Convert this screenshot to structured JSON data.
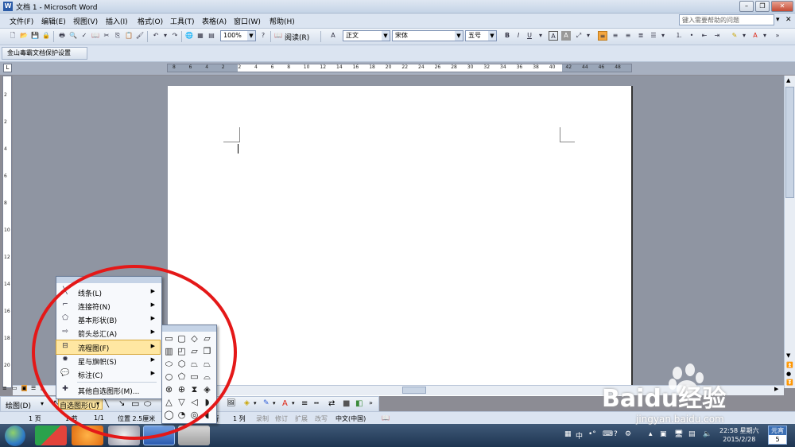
{
  "window": {
    "title": "文档 1 - Microsoft Word"
  },
  "menubar": {
    "items": [
      "文件(F)",
      "编辑(E)",
      "视图(V)",
      "插入(I)",
      "格式(O)",
      "工具(T)",
      "表格(A)",
      "窗口(W)",
      "帮助(H)"
    ],
    "help_placeholder": "键入需要帮助的问题"
  },
  "toolbar": {
    "zoom": "100%",
    "read_label": "阅读(R)",
    "style": "正文",
    "font": "宋体",
    "size": "五号"
  },
  "toolbar2": {
    "protect_label": "金山毒霸文档保护设置"
  },
  "ruler": {
    "h_numbers": [
      "8",
      "6",
      "4",
      "2",
      "2",
      "4",
      "6",
      "8",
      "10",
      "12",
      "14",
      "16",
      "18",
      "20",
      "22",
      "24",
      "26",
      "28",
      "30",
      "32",
      "34",
      "36",
      "38",
      "40",
      "42",
      "44",
      "46",
      "48"
    ],
    "v_numbers": [
      "2",
      "2",
      "4",
      "6",
      "8",
      "10",
      "12",
      "14",
      "16",
      "18",
      "20"
    ]
  },
  "autoshape_menu": {
    "items": [
      {
        "label": "线条(L)",
        "icon": "line-icon",
        "sub": true
      },
      {
        "label": "连接符(N)",
        "icon": "connector-icon",
        "sub": true
      },
      {
        "label": "基本形状(B)",
        "icon": "basic-shapes-icon",
        "sub": true
      },
      {
        "label": "箭头总汇(A)",
        "icon": "arrows-icon",
        "sub": true
      },
      {
        "label": "流程图(F)",
        "icon": "flowchart-icon",
        "sub": true,
        "highlighted": true
      },
      {
        "label": "星与旗帜(S)",
        "icon": "star-icon",
        "sub": true
      },
      {
        "label": "标注(C)",
        "icon": "callout-icon",
        "sub": true
      },
      {
        "label": "其他自选图形(M)...",
        "icon": "more-shapes-icon",
        "sub": false
      }
    ]
  },
  "flowchart_shapes": [
    "process",
    "alternate-process",
    "decision",
    "data",
    "predefined-process",
    "internal-storage",
    "document",
    "multidocument",
    "terminator",
    "preparation",
    "manual-input",
    "manual-operation",
    "connector",
    "offpage-connector",
    "card",
    "punched-tape",
    "summing-junction",
    "or",
    "collate",
    "sort",
    "extract",
    "merge",
    "stored-data",
    "delay",
    "sequential-storage",
    "magnetic-disk",
    "direct-access",
    "display"
  ],
  "drawbar": {
    "draw_label": "绘图(D)",
    "autoshape_label": "自选图形(U)"
  },
  "statusbar": {
    "page": "1 页",
    "section": "1 节",
    "pages": "1/1",
    "position": "位置 2.5厘米",
    "line": "1 行",
    "col": "1 列",
    "rec": "录制",
    "trk": "修订",
    "ext": "扩展",
    "ovr": "改写",
    "lang": "中文(中国)"
  },
  "taskbar": {
    "ime": "中",
    "time": "22:58 星期六",
    "date": "2015/2/28",
    "yuanxiao": "元宵",
    "yuanxiao_num": "5"
  },
  "watermark": {
    "brand": "Baidu经验",
    "url": "jingyan.baidu.com"
  }
}
